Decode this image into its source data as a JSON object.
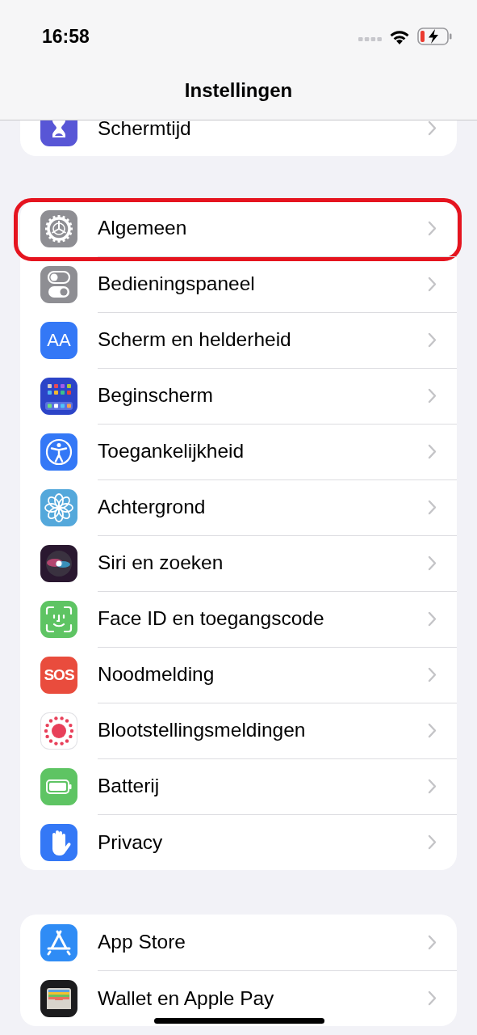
{
  "status_bar": {
    "time": "16:58"
  },
  "navigation_bar": {
    "title": "Instellingen"
  },
  "groups": [
    {
      "items": [
        {
          "label": "Schermtijd",
          "color": "#5856d6",
          "highlighted": false
        }
      ]
    },
    {
      "items": [
        {
          "label": "Algemeen",
          "color": "#8e8e93",
          "highlighted": true
        },
        {
          "label": "Bedieningspaneel",
          "color": "#8e8e93",
          "highlighted": false
        },
        {
          "label": "Scherm en helderheid",
          "color": "#3478f6",
          "icon_text": "AA",
          "highlighted": false
        },
        {
          "label": "Beginscherm",
          "color": "#2c44c8",
          "highlighted": false
        },
        {
          "label": "Toegankelijkheid",
          "color": "#3478f6",
          "highlighted": false
        },
        {
          "label": "Achtergrond",
          "color": "#54a8db",
          "highlighted": false
        },
        {
          "label": "Siri en zoeken",
          "color": "#2a1830",
          "highlighted": false
        },
        {
          "label": "Face ID en toegangscode",
          "color": "#5ec463",
          "highlighted": false
        },
        {
          "label": "Noodmelding",
          "color": "#e94c3d",
          "icon_text": "SOS",
          "highlighted": false
        },
        {
          "label": "Blootstellingsmeldingen",
          "color": "#ffffff",
          "highlighted": false
        },
        {
          "label": "Batterij",
          "color": "#5ec463",
          "highlighted": false
        },
        {
          "label": "Privacy",
          "color": "#3478f6",
          "highlighted": false
        }
      ]
    },
    {
      "items": [
        {
          "label": "App Store",
          "color": "#2f8cf5",
          "highlighted": false
        },
        {
          "label": "Wallet en Apple Pay",
          "color": "#1c1c1e",
          "highlighted": false
        }
      ]
    }
  ]
}
